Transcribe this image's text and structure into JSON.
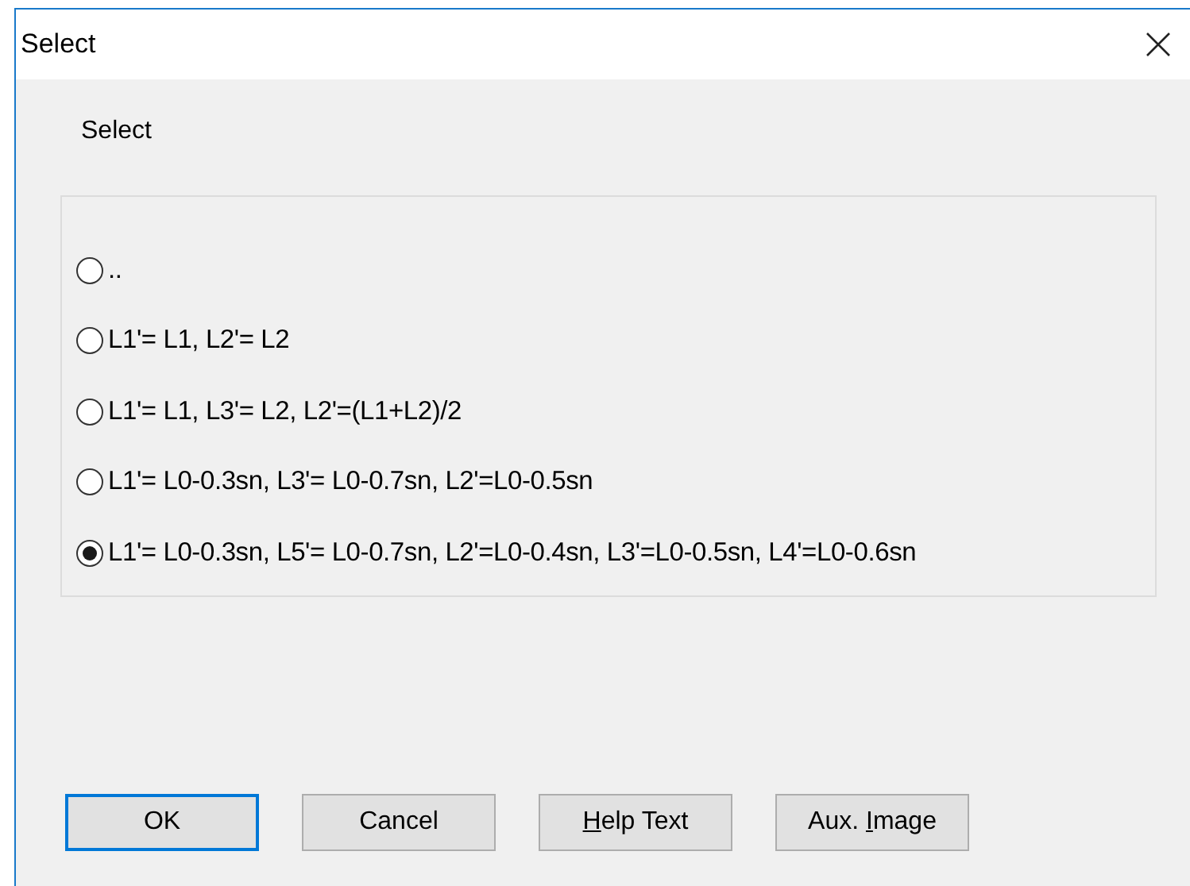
{
  "window": {
    "title": "Select"
  },
  "prompt": "Select",
  "options": [
    {
      "label": "..",
      "selected": false
    },
    {
      "label": "L1'= L1, L2'= L2",
      "selected": false
    },
    {
      "label": "L1'= L1, L3'= L2, L2'=(L1+L2)/2",
      "selected": false
    },
    {
      "label": "L1'= L0-0.3sn, L3'= L0-0.7sn, L2'=L0-0.5sn",
      "selected": false
    },
    {
      "label": "L1'= L0-0.3sn, L5'= L0-0.7sn, L2'=L0-0.4sn, L3'=L0-0.5sn, L4'=L0-0.6sn",
      "selected": true
    }
  ],
  "buttons": [
    {
      "pre": "OK",
      "default": true
    },
    {
      "pre": "Cancel",
      "default": false
    },
    {
      "key": "H",
      "post": "elp Text",
      "default": false
    },
    {
      "pre": "Aux. ",
      "key": "I",
      "post": "mage",
      "default": false
    }
  ]
}
